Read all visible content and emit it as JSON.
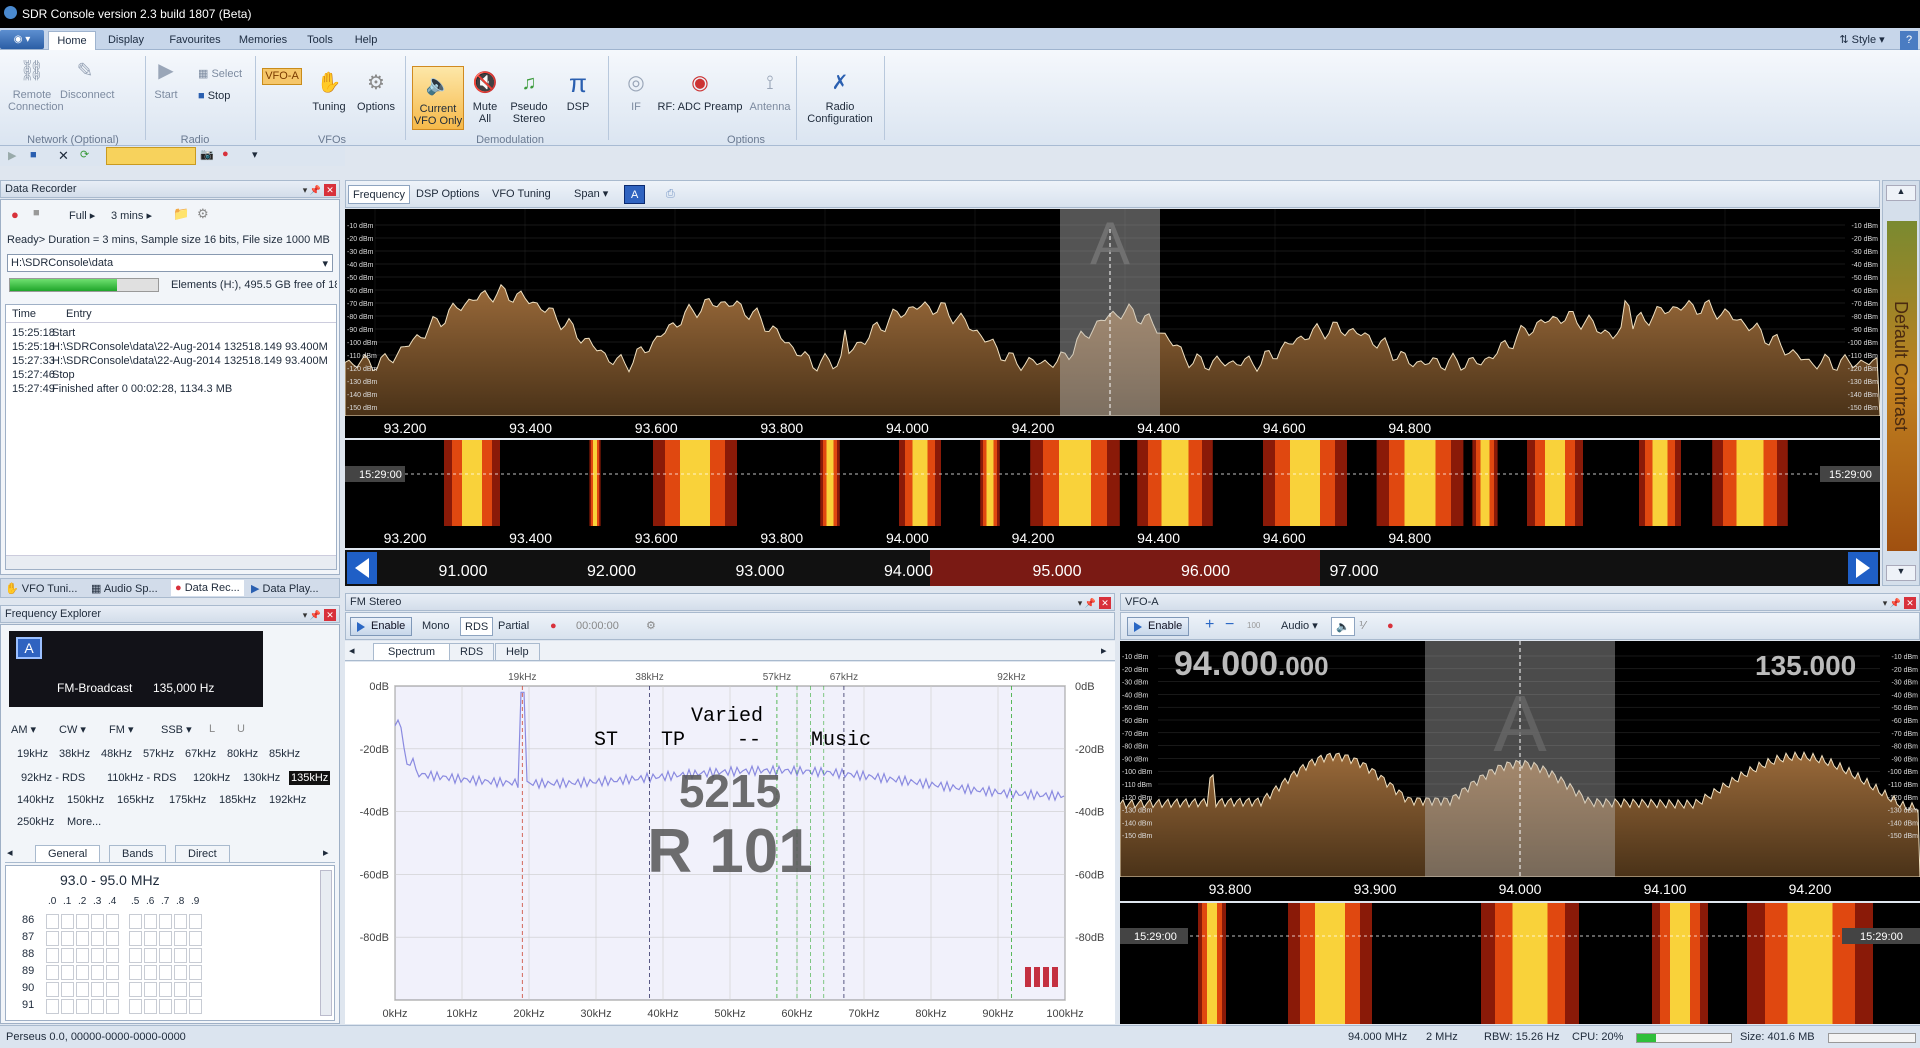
{
  "window": {
    "title": "SDR Console version 2.3 build 1807 (Beta)"
  },
  "ribbon_tabs": [
    "Home",
    "Display",
    "Favourites",
    "Memories",
    "Tools",
    "Help"
  ],
  "style_label": "Style",
  "ribbon": {
    "remote_connection": "Remote\nConnection",
    "disconnect": "Disconnect",
    "group_network": "Network (Optional)",
    "start": "Start",
    "select": "Select",
    "stop": "Stop",
    "group_radio": "Radio",
    "vfo_a": "VFO-A",
    "tuning": "Tuning",
    "options": "Options",
    "group_vfos": "VFOs",
    "current_vfo": "Current\nVFO Only",
    "mute_all": "Mute\nAll",
    "pseudo_stereo": "Pseudo\nStereo",
    "dsp": "DSP",
    "group_demod": "Demodulation",
    "if": "IF",
    "rf_adc": "RF: ADC Preamp",
    "antenna": "Antenna",
    "group_options": "Options",
    "radio_config": "Radio\nConfiguration"
  },
  "data_recorder": {
    "title": "Data Recorder",
    "mode": "Full",
    "duration": "3 mins",
    "status": "Ready> Duration = 3 mins, Sample size 16 bits, File size 1000 MB",
    "path": "H:\\SDRConsole\\data",
    "disk": "Elements (H:), 495.5 GB free of 18",
    "disk_fraction": 0.72,
    "col_time": "Time",
    "col_entry": "Entry",
    "log": [
      {
        "time": "15:25:18",
        "entry": "Start"
      },
      {
        "time": "15:25:18",
        "entry": "H:\\SDRConsole\\data\\22-Aug-2014 132518.149 93.400M"
      },
      {
        "time": "15:27:33",
        "entry": "H:\\SDRConsole\\data\\22-Aug-2014 132518.149 93.400M"
      },
      {
        "time": "15:27:46",
        "entry": "Stop"
      },
      {
        "time": "15:27:49",
        "entry": "Finished after 0 00:02:28, 1134.3 MB"
      }
    ]
  },
  "dock_tabs": [
    "VFO Tuni...",
    "Audio Sp...",
    "Data Rec...",
    "Data Play..."
  ],
  "freq_explorer": {
    "title": "Frequency Explorer",
    "badge": "A",
    "band": "FM-Broadcast",
    "band_freq": "135,000 Hz",
    "modes": [
      "AM",
      "CW",
      "FM",
      "SSB",
      "L",
      "U"
    ],
    "presets": [
      [
        "19kHz",
        "38kHz",
        "48kHz",
        "57kHz",
        "67kHz",
        "80kHz",
        "85kHz"
      ],
      [
        "92kHz - RDS",
        "110kHz - RDS",
        "120kHz",
        "130kHz",
        "135kHz"
      ],
      [
        "140kHz",
        "150kHz",
        "165kHz",
        "175kHz",
        "185kHz",
        "192kHz"
      ],
      [
        "250kHz",
        "More..."
      ]
    ],
    "selected_preset": "135kHz",
    "tabs": [
      "General",
      "Bands",
      "Direct"
    ],
    "range": "93.0 - 95.0 MHz",
    "decimals": [
      ".0",
      ".1",
      ".2",
      ".3",
      ".4",
      ".5",
      ".6",
      ".7",
      ".8",
      ".9"
    ],
    "rows": [
      "86",
      "87",
      "88",
      "89",
      "90",
      "91"
    ]
  },
  "main_spectrum": {
    "toolbar": [
      "Frequency",
      "DSP Options",
      "VFO Tuning",
      "Span"
    ],
    "vfo_badge": "A",
    "db_labels": [
      "-10 dBm",
      "-20 dBm",
      "-30 dBm",
      "-40 dBm",
      "-50 dBm",
      "-60 dBm",
      "-70 dBm",
      "-80 dBm",
      "-90 dBm",
      "-100 dBm",
      "-110 dBm",
      "-120 dBm",
      "-130 dBm",
      "-140 dBm",
      "-150 dBm"
    ],
    "freq_labels": [
      "93.200",
      "93.400",
      "93.600",
      "93.800",
      "94.000",
      "94.200",
      "94.400",
      "94.600",
      "94.800"
    ],
    "waterfall_time": "15:29:00",
    "band_labels": [
      "91.000",
      "92.000",
      "93.000",
      "94.000",
      "95.000",
      "96.000",
      "97.000"
    ],
    "contrast_label": "Default Contrast",
    "center_letter": "A"
  },
  "fm_stereo": {
    "title": "FM Stereo",
    "enable": "Enable",
    "mono": "Mono",
    "rds": "RDS",
    "partial": "Partial",
    "timer": "00:00:00",
    "tabs": [
      "Spectrum",
      "RDS",
      "Help"
    ],
    "markers": [
      "19kHz",
      "38kHz",
      "57kHz",
      "67kHz",
      "92kHz"
    ],
    "db_labels": [
      "0dB",
      "-20dB",
      "-40dB",
      "-60dB",
      "-80dB"
    ],
    "x_labels": [
      "0kHz",
      "10kHz",
      "20kHz",
      "30kHz",
      "40kHz",
      "50kHz",
      "60kHz",
      "70kHz",
      "80kHz",
      "90kHz",
      "100kHz"
    ],
    "rds_text": {
      "varied": "Varied",
      "st": "ST",
      "tp": "TP",
      "dash": "--",
      "music": "Music"
    },
    "pi_code": "5215",
    "station": "R 101"
  },
  "vfo_panel": {
    "title": "VFO-A",
    "enable": "Enable",
    "step": "100",
    "audio": "Audio",
    "freq_main": "94.000",
    "freq_sub": ".000",
    "bandwidth": "135.000",
    "center_letter": "A",
    "db_labels": [
      "-10 dBm",
      "-20 dBm",
      "-30 dBm",
      "-40 dBm",
      "-50 dBm",
      "-60 dBm",
      "-70 dBm",
      "-80 dBm",
      "-90 dBm",
      "-100 dBm",
      "-110 dBm",
      "-120 dBm",
      "-130 dBm",
      "-140 dBm",
      "-150 dBm"
    ],
    "freq_labels": [
      "93.800",
      "93.900",
      "94.000",
      "94.100",
      "94.200"
    ],
    "waterfall_time": "15:29:00"
  },
  "status": {
    "device": "Perseus 0.0, 00000-0000-0000-0000",
    "freq": "94.000 MHz",
    "bw": "2 MHz",
    "rbw": "RBW: 15.26 Hz",
    "cpu": "CPU: 20%",
    "cpu_fraction": 0.2,
    "size": "Size: 401.6 MB"
  }
}
